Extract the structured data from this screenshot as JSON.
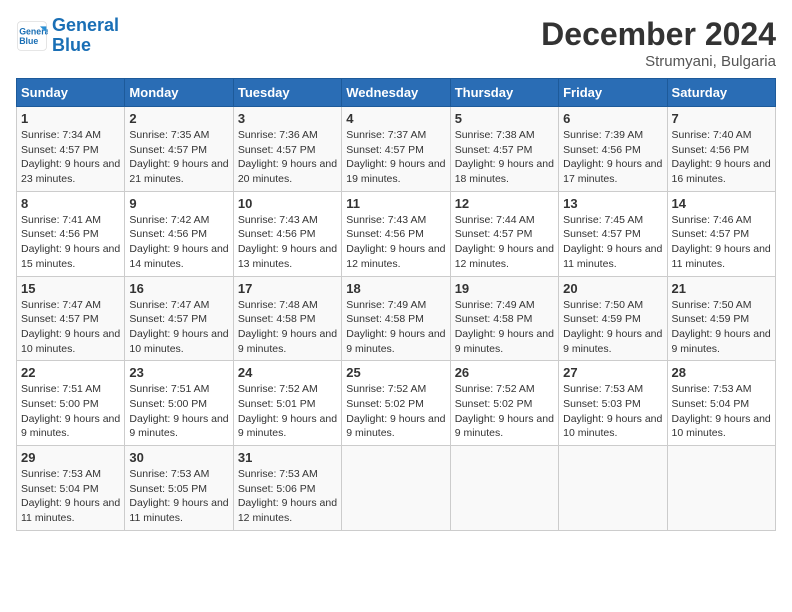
{
  "header": {
    "logo_line1": "General",
    "logo_line2": "Blue",
    "month": "December 2024",
    "location": "Strumyani, Bulgaria"
  },
  "days_of_week": [
    "Sunday",
    "Monday",
    "Tuesday",
    "Wednesday",
    "Thursday",
    "Friday",
    "Saturday"
  ],
  "weeks": [
    [
      {
        "day": 1,
        "sunrise": "7:34 AM",
        "sunset": "4:57 PM",
        "daylight": "9 hours and 23 minutes."
      },
      {
        "day": 2,
        "sunrise": "7:35 AM",
        "sunset": "4:57 PM",
        "daylight": "9 hours and 21 minutes."
      },
      {
        "day": 3,
        "sunrise": "7:36 AM",
        "sunset": "4:57 PM",
        "daylight": "9 hours and 20 minutes."
      },
      {
        "day": 4,
        "sunrise": "7:37 AM",
        "sunset": "4:57 PM",
        "daylight": "9 hours and 19 minutes."
      },
      {
        "day": 5,
        "sunrise": "7:38 AM",
        "sunset": "4:57 PM",
        "daylight": "9 hours and 18 minutes."
      },
      {
        "day": 6,
        "sunrise": "7:39 AM",
        "sunset": "4:56 PM",
        "daylight": "9 hours and 17 minutes."
      },
      {
        "day": 7,
        "sunrise": "7:40 AM",
        "sunset": "4:56 PM",
        "daylight": "9 hours and 16 minutes."
      }
    ],
    [
      {
        "day": 8,
        "sunrise": "7:41 AM",
        "sunset": "4:56 PM",
        "daylight": "9 hours and 15 minutes."
      },
      {
        "day": 9,
        "sunrise": "7:42 AM",
        "sunset": "4:56 PM",
        "daylight": "9 hours and 14 minutes."
      },
      {
        "day": 10,
        "sunrise": "7:43 AM",
        "sunset": "4:56 PM",
        "daylight": "9 hours and 13 minutes."
      },
      {
        "day": 11,
        "sunrise": "7:43 AM",
        "sunset": "4:56 PM",
        "daylight": "9 hours and 12 minutes."
      },
      {
        "day": 12,
        "sunrise": "7:44 AM",
        "sunset": "4:57 PM",
        "daylight": "9 hours and 12 minutes."
      },
      {
        "day": 13,
        "sunrise": "7:45 AM",
        "sunset": "4:57 PM",
        "daylight": "9 hours and 11 minutes."
      },
      {
        "day": 14,
        "sunrise": "7:46 AM",
        "sunset": "4:57 PM",
        "daylight": "9 hours and 11 minutes."
      }
    ],
    [
      {
        "day": 15,
        "sunrise": "7:47 AM",
        "sunset": "4:57 PM",
        "daylight": "9 hours and 10 minutes."
      },
      {
        "day": 16,
        "sunrise": "7:47 AM",
        "sunset": "4:57 PM",
        "daylight": "9 hours and 10 minutes."
      },
      {
        "day": 17,
        "sunrise": "7:48 AM",
        "sunset": "4:58 PM",
        "daylight": "9 hours and 9 minutes."
      },
      {
        "day": 18,
        "sunrise": "7:49 AM",
        "sunset": "4:58 PM",
        "daylight": "9 hours and 9 minutes."
      },
      {
        "day": 19,
        "sunrise": "7:49 AM",
        "sunset": "4:58 PM",
        "daylight": "9 hours and 9 minutes."
      },
      {
        "day": 20,
        "sunrise": "7:50 AM",
        "sunset": "4:59 PM",
        "daylight": "9 hours and 9 minutes."
      },
      {
        "day": 21,
        "sunrise": "7:50 AM",
        "sunset": "4:59 PM",
        "daylight": "9 hours and 9 minutes."
      }
    ],
    [
      {
        "day": 22,
        "sunrise": "7:51 AM",
        "sunset": "5:00 PM",
        "daylight": "9 hours and 9 minutes."
      },
      {
        "day": 23,
        "sunrise": "7:51 AM",
        "sunset": "5:00 PM",
        "daylight": "9 hours and 9 minutes."
      },
      {
        "day": 24,
        "sunrise": "7:52 AM",
        "sunset": "5:01 PM",
        "daylight": "9 hours and 9 minutes."
      },
      {
        "day": 25,
        "sunrise": "7:52 AM",
        "sunset": "5:02 PM",
        "daylight": "9 hours and 9 minutes."
      },
      {
        "day": 26,
        "sunrise": "7:52 AM",
        "sunset": "5:02 PM",
        "daylight": "9 hours and 9 minutes."
      },
      {
        "day": 27,
        "sunrise": "7:53 AM",
        "sunset": "5:03 PM",
        "daylight": "9 hours and 10 minutes."
      },
      {
        "day": 28,
        "sunrise": "7:53 AM",
        "sunset": "5:04 PM",
        "daylight": "9 hours and 10 minutes."
      }
    ],
    [
      {
        "day": 29,
        "sunrise": "7:53 AM",
        "sunset": "5:04 PM",
        "daylight": "9 hours and 11 minutes."
      },
      {
        "day": 30,
        "sunrise": "7:53 AM",
        "sunset": "5:05 PM",
        "daylight": "9 hours and 11 minutes."
      },
      {
        "day": 31,
        "sunrise": "7:53 AM",
        "sunset": "5:06 PM",
        "daylight": "9 hours and 12 minutes."
      },
      null,
      null,
      null,
      null
    ]
  ]
}
